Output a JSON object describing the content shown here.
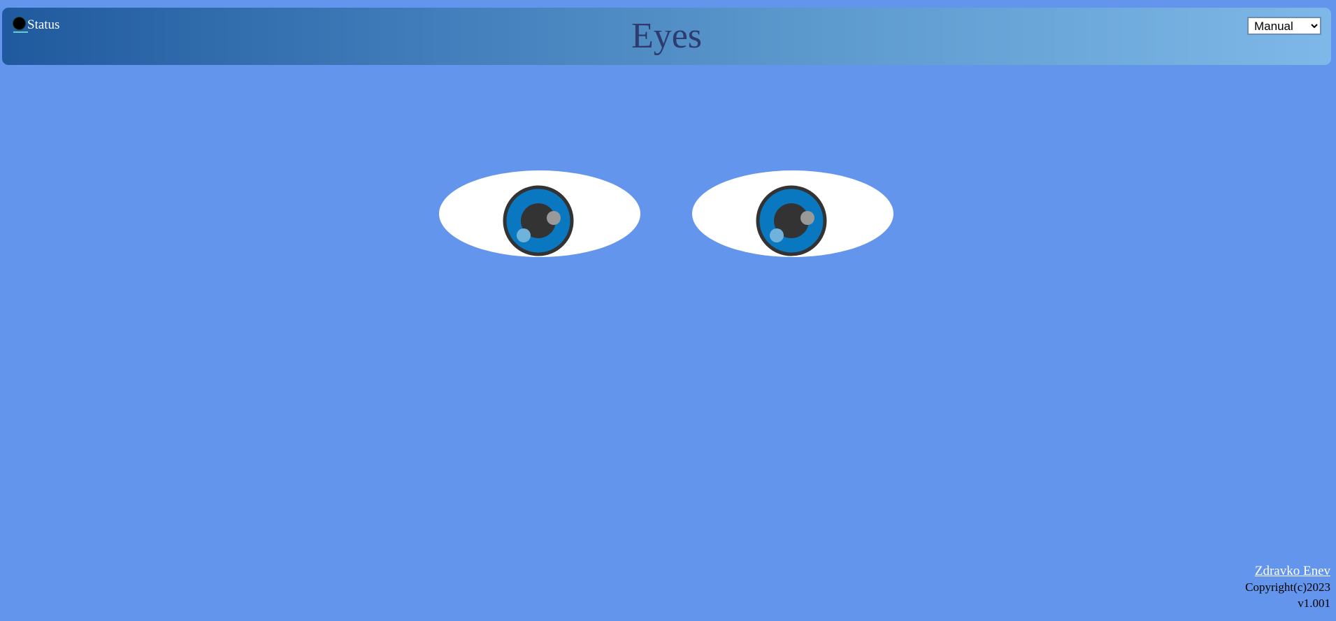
{
  "header": {
    "status_label": "Status",
    "title": "Eyes",
    "mode_select": {
      "selected": "Manual",
      "options": [
        "Manual"
      ]
    }
  },
  "eyes": {
    "count": 2,
    "iris_color": "#0a78c0",
    "pupil_color": "#333333",
    "sclera_color": "#ffffff"
  },
  "footer": {
    "author": "Zdravko Enev",
    "copyright": "Copyright(c)2023",
    "version": "v1.001"
  },
  "colors": {
    "background": "#6495ED",
    "title": "#2d3b6e"
  }
}
